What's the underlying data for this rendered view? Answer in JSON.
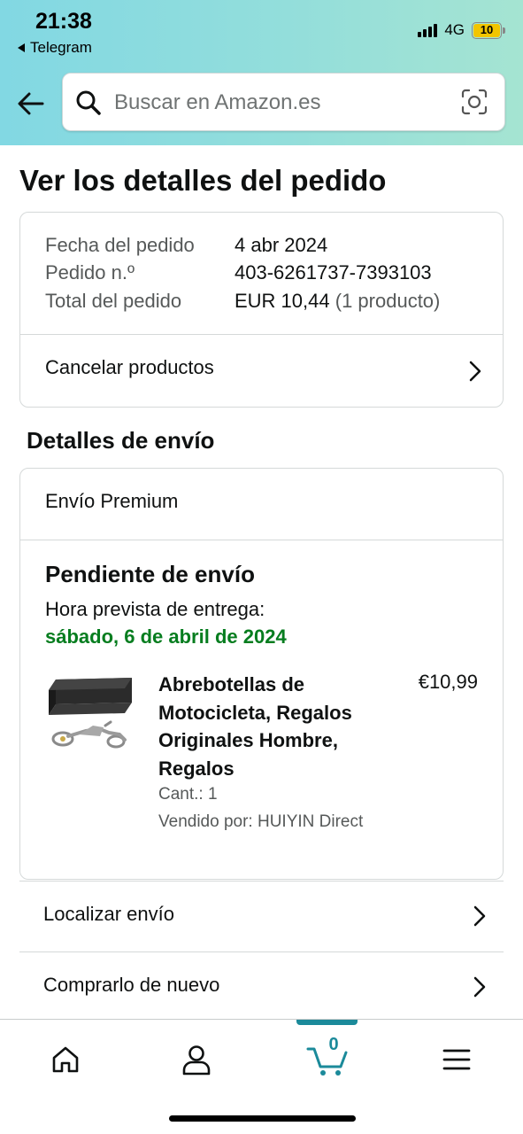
{
  "status_bar": {
    "time": "21:38",
    "back_app": "Telegram",
    "network": "4G",
    "battery": "10"
  },
  "search": {
    "placeholder": "Buscar en Amazon.es"
  },
  "page": {
    "title": "Ver los detalles del pedido"
  },
  "order_summary": {
    "date_label": "Fecha del pedido",
    "date_value": "4 abr 2024",
    "number_label": "Pedido n.º",
    "number_value": "403-6261737-7393103",
    "total_label": "Total del pedido",
    "total_value": "EUR 10,44",
    "total_items": "(1 producto)",
    "cancel_label": "Cancelar productos"
  },
  "shipping": {
    "section_title": "Detalles de envío",
    "type": "Envío Premium",
    "status": "Pendiente de envío",
    "eta_label": "Hora prevista de entrega:",
    "eta_date": "sábado, 6 de abril de 2024",
    "product": {
      "title": "Abrebotellas de Motocicleta, Regalos Originales Hombre, Regalos",
      "price": "€10,99",
      "quantity": "Cant.: 1",
      "seller": "Vendido por: HUIYIN Direct"
    }
  },
  "actions": {
    "track": "Localizar envío",
    "buy_again": "Comprarlo de nuevo"
  },
  "bottom_nav": {
    "cart_count": "0",
    "active_tab": "cart",
    "accent_color": "#1b8a9a"
  },
  "colors": {
    "delivery_green": "#067d1f",
    "header_gradient_start": "#82d8e3",
    "header_gradient_end": "#a5e4d2"
  }
}
